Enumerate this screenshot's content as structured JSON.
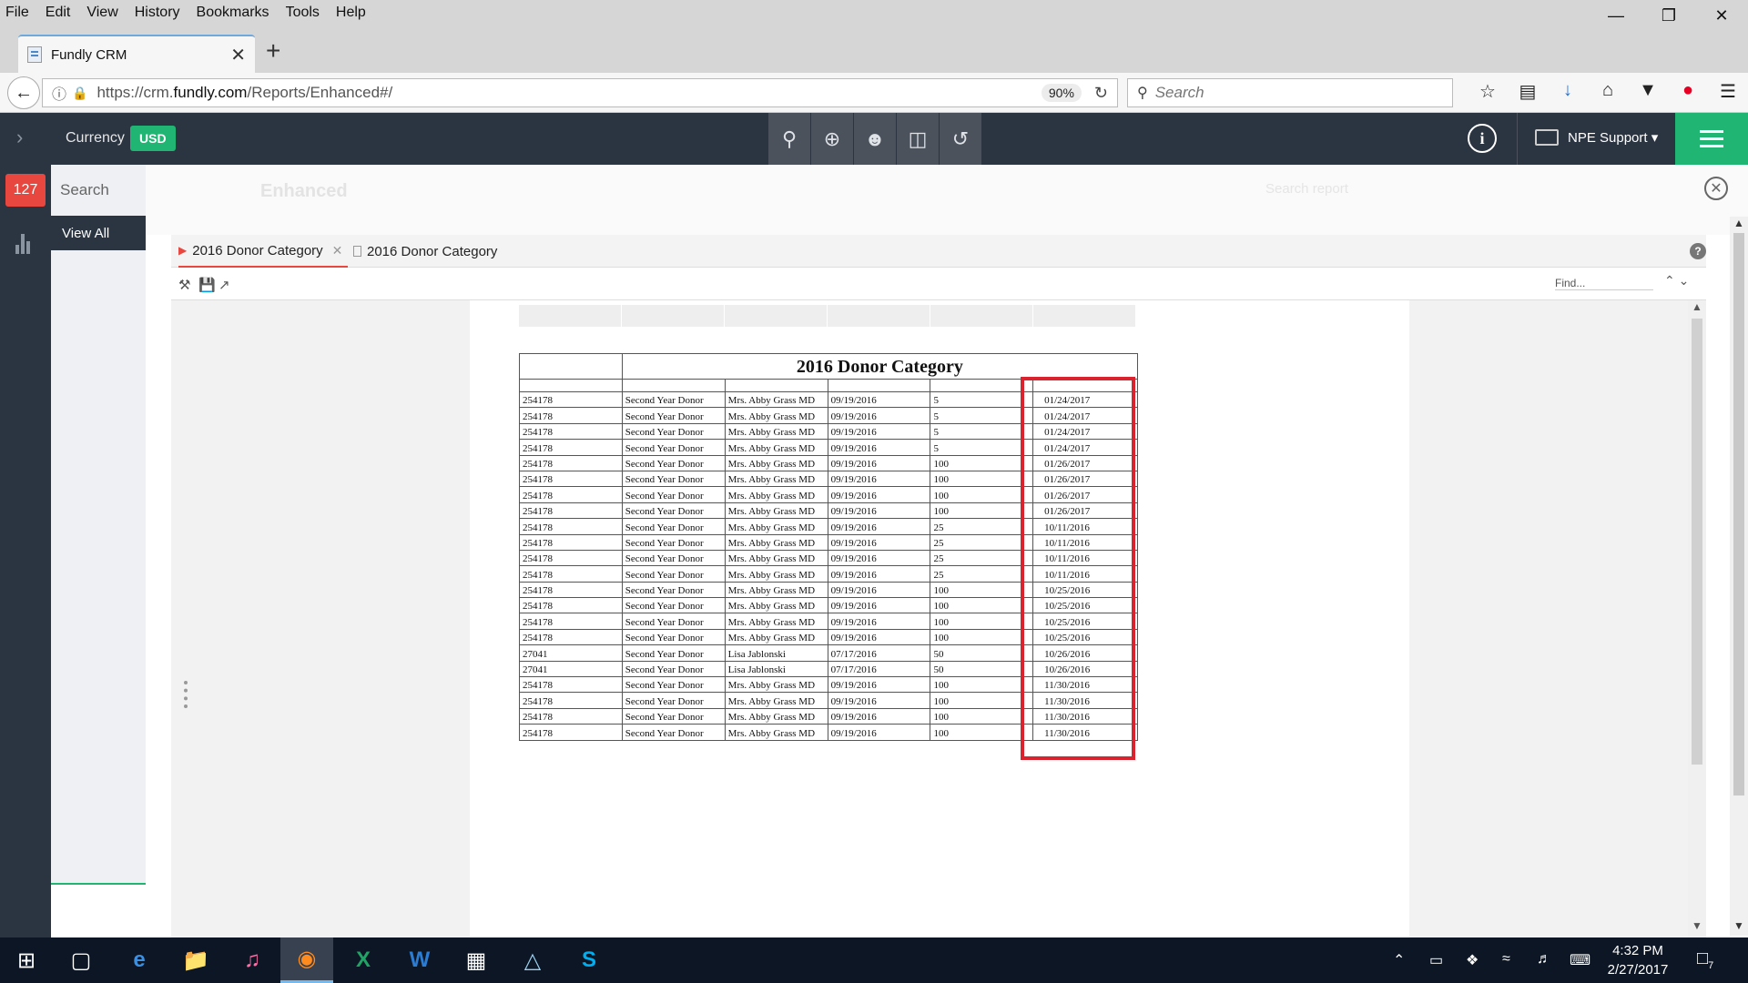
{
  "menubar": {
    "items": [
      "File",
      "Edit",
      "View",
      "History",
      "Bookmarks",
      "Tools",
      "Help"
    ]
  },
  "window_controls": {
    "minimize": "—",
    "restore": "❐",
    "close": "✕"
  },
  "browser_tab": {
    "title": "Fundly CRM",
    "close": "✕",
    "new_tab": "+"
  },
  "navbar": {
    "url_prefix": "https://crm.",
    "url_domain": "fundly.com",
    "url_path": "/Reports/Enhanced#/",
    "zoom": "90%",
    "search_placeholder": "Search"
  },
  "app_header": {
    "currency_label": "Currency",
    "currency_value": "USD",
    "user_menu": "NPE Support",
    "info_icon": "i",
    "center_icons": [
      "search-icon",
      "add-icon",
      "person-icon",
      "records-icon",
      "history-icon"
    ]
  },
  "left_sidebar": {
    "badge": "127"
  },
  "secondary_sidebar": {
    "search_placeholder": "Search",
    "view_all": "View All"
  },
  "faint_header": {
    "title": "Enhanced",
    "search_hint": "Search report"
  },
  "viewer": {
    "tabs": [
      {
        "label": "2016 Donor Category",
        "active": true
      },
      {
        "label": "2016 Donor Category",
        "active": false
      }
    ],
    "help": "?",
    "find_placeholder": "Find..."
  },
  "report": {
    "title": "2016 Donor Category",
    "rows": [
      [
        "254178",
        "Second Year Donor",
        "Mrs. Abby Grass MD",
        "09/19/2016",
        "5",
        "01/24/2017"
      ],
      [
        "254178",
        "Second Year Donor",
        "Mrs. Abby Grass MD",
        "09/19/2016",
        "5",
        "01/24/2017"
      ],
      [
        "254178",
        "Second Year Donor",
        "Mrs. Abby Grass MD",
        "09/19/2016",
        "5",
        "01/24/2017"
      ],
      [
        "254178",
        "Second Year Donor",
        "Mrs. Abby Grass MD",
        "09/19/2016",
        "5",
        "01/24/2017"
      ],
      [
        "254178",
        "Second Year Donor",
        "Mrs. Abby Grass MD",
        "09/19/2016",
        "100",
        "01/26/2017"
      ],
      [
        "254178",
        "Second Year Donor",
        "Mrs. Abby Grass MD",
        "09/19/2016",
        "100",
        "01/26/2017"
      ],
      [
        "254178",
        "Second Year Donor",
        "Mrs. Abby Grass MD",
        "09/19/2016",
        "100",
        "01/26/2017"
      ],
      [
        "254178",
        "Second Year Donor",
        "Mrs. Abby Grass MD",
        "09/19/2016",
        "100",
        "01/26/2017"
      ],
      [
        "254178",
        "Second Year Donor",
        "Mrs. Abby Grass MD",
        "09/19/2016",
        "25",
        "10/11/2016"
      ],
      [
        "254178",
        "Second Year Donor",
        "Mrs. Abby Grass MD",
        "09/19/2016",
        "25",
        "10/11/2016"
      ],
      [
        "254178",
        "Second Year Donor",
        "Mrs. Abby Grass MD",
        "09/19/2016",
        "25",
        "10/11/2016"
      ],
      [
        "254178",
        "Second Year Donor",
        "Mrs. Abby Grass MD",
        "09/19/2016",
        "25",
        "10/11/2016"
      ],
      [
        "254178",
        "Second Year Donor",
        "Mrs. Abby Grass MD",
        "09/19/2016",
        "100",
        "10/25/2016"
      ],
      [
        "254178",
        "Second Year Donor",
        "Mrs. Abby Grass MD",
        "09/19/2016",
        "100",
        "10/25/2016"
      ],
      [
        "254178",
        "Second Year Donor",
        "Mrs. Abby Grass MD",
        "09/19/2016",
        "100",
        "10/25/2016"
      ],
      [
        "254178",
        "Second Year Donor",
        "Mrs. Abby Grass MD",
        "09/19/2016",
        "100",
        "10/25/2016"
      ],
      [
        "27041",
        "Second Year Donor",
        "Lisa Jablonski",
        "07/17/2016",
        "50",
        "10/26/2016"
      ],
      [
        "27041",
        "Second Year Donor",
        "Lisa Jablonski",
        "07/17/2016",
        "50",
        "10/26/2016"
      ],
      [
        "254178",
        "Second Year Donor",
        "Mrs. Abby Grass MD",
        "09/19/2016",
        "100",
        "11/30/2016"
      ],
      [
        "254178",
        "Second Year Donor",
        "Mrs. Abby Grass MD",
        "09/19/2016",
        "100",
        "11/30/2016"
      ],
      [
        "254178",
        "Second Year Donor",
        "Mrs. Abby Grass MD",
        "09/19/2016",
        "100",
        "11/30/2016"
      ],
      [
        "254178",
        "Second Year Donor",
        "Mrs. Abby Grass MD",
        "09/19/2016",
        "100",
        "11/30/2016"
      ]
    ]
  },
  "taskbar": {
    "time": "4:32 PM",
    "date": "2/27/2017",
    "notification_count": "7"
  },
  "colors": {
    "accent_green": "#21b573",
    "badge_red": "#e8473f",
    "header_dark": "#2b3441",
    "highlight_red": "#d9232e"
  }
}
